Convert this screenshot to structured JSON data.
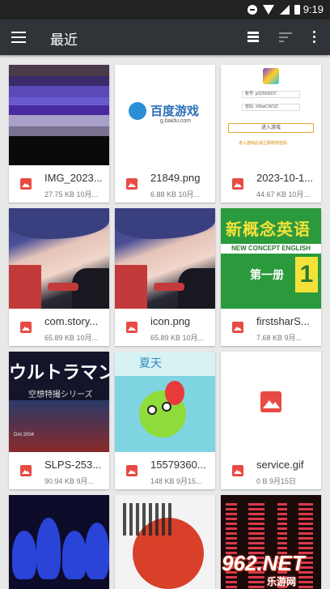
{
  "status_bar": {
    "time": "9:19"
  },
  "app_bar": {
    "title": "最近"
  },
  "files": [
    {
      "name": "IMG_2023...",
      "meta": "27.75 KB 10月..."
    },
    {
      "name": "21849.png",
      "meta": "6.88 KB 10月..."
    },
    {
      "name": "2023-10-1...",
      "meta": "44.67 KB 10月..."
    },
    {
      "name": "com.story...",
      "meta": "65.89 KB 10月..."
    },
    {
      "name": "icon.png",
      "meta": "65.89 KB 10月..."
    },
    {
      "name": "firstsharS...",
      "meta": "7.68 KB 9月..."
    },
    {
      "name": "SLPS-253...",
      "meta": "90.94 KB 9月..."
    },
    {
      "name": "15579360...",
      "meta": "148 KB 9月15..."
    },
    {
      "name": "service.gif",
      "meta": "0 B 9月15日"
    }
  ],
  "thumb_text": {
    "baidu_logo": "百度游戏",
    "baidu_url": "g.baidu.com",
    "login_account": "账号: jc02553937",
    "login_password": "密码: X6bsiCW1IC",
    "login_button": "进入游戏",
    "login_note": "进入游戏后请立即修改密码",
    "english_big": "新概念英语",
    "english_band": "NEW CONCEPT ENGLISH",
    "english_vol": "第一册",
    "english_one": "1",
    "ultra_title": "ウルトラマン",
    "ultra_sub": "空想特撮シリーズ",
    "ultra_tiny": "DAI 2004",
    "summer_title": "夏天"
  },
  "watermark": {
    "main": "962.NET",
    "sub": "乐游网"
  },
  "colors": {
    "appbar": "#303438",
    "statusbar": "#222222",
    "file_icon": "#e84b43",
    "background": "#e9e9e9"
  }
}
